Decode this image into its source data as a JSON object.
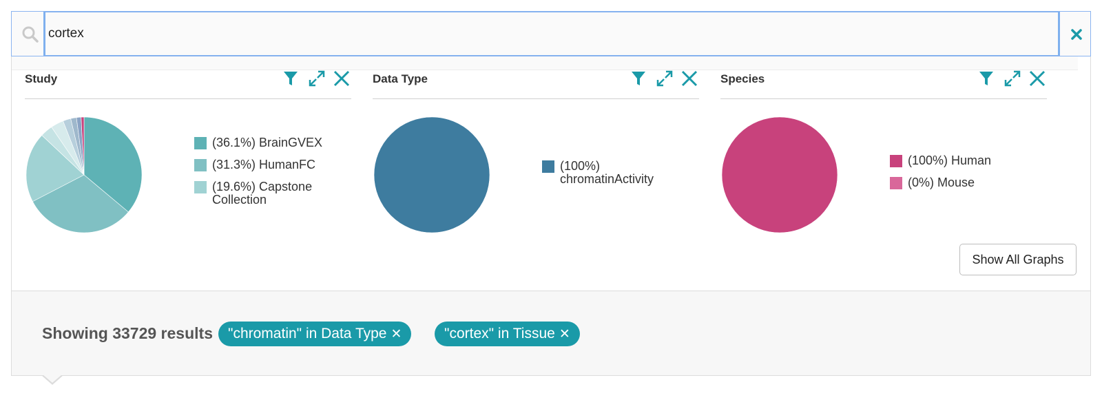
{
  "search": {
    "value": "cortex",
    "icons": {
      "search": "search-icon",
      "clear": "close-icon"
    }
  },
  "cards": [
    {
      "title": "Study",
      "legend": [
        {
          "label": "(36.1%) BrainGVEX",
          "color": "#5eb2b5"
        },
        {
          "label": "(31.3%) HumanFC",
          "color": "#80c0c3"
        },
        {
          "label": "(19.6%) Capstone Collection",
          "color": "#a0d2d3"
        }
      ]
    },
    {
      "title": "Data Type",
      "legend": [
        {
          "label": "(100%) chromatinActivity",
          "color": "#3e7c9f"
        }
      ]
    },
    {
      "title": "Species",
      "legend": [
        {
          "label": "(100%) Human",
          "color": "#c8427c"
        },
        {
          "label": "(0%) Mouse",
          "color": "#d9679a"
        }
      ]
    }
  ],
  "tool_icons": [
    "filter-icon",
    "expand-icon",
    "close-icon"
  ],
  "show_all_label": "Show All Graphs",
  "results": {
    "text": "Showing 33729 results",
    "chips": [
      {
        "label": "\"chromatin\" in Data Type"
      },
      {
        "label": "\"cortex\" in Tissue"
      }
    ]
  },
  "colors": {
    "accent": "#1a9aa8",
    "study_pie_tail": [
      "#c5e3e4",
      "#d7ebec",
      "#b7cfdc",
      "#9fb8cc",
      "#8aa3c4",
      "#c8427c"
    ]
  },
  "chart_data": [
    {
      "type": "pie",
      "title": "Study",
      "categories": [
        "BrainGVEX",
        "HumanFC",
        "Capstone Collection",
        "",
        "",
        "",
        "",
        "",
        ""
      ],
      "values": [
        36.1,
        31.3,
        19.6,
        3.5,
        3.6,
        2.2,
        1.6,
        1.3,
        0.8
      ]
    },
    {
      "type": "pie",
      "title": "Data Type",
      "categories": [
        "chromatinActivity"
      ],
      "values": [
        100
      ]
    },
    {
      "type": "pie",
      "title": "Species",
      "categories": [
        "Human",
        "Mouse"
      ],
      "values": [
        100,
        0
      ]
    }
  ]
}
